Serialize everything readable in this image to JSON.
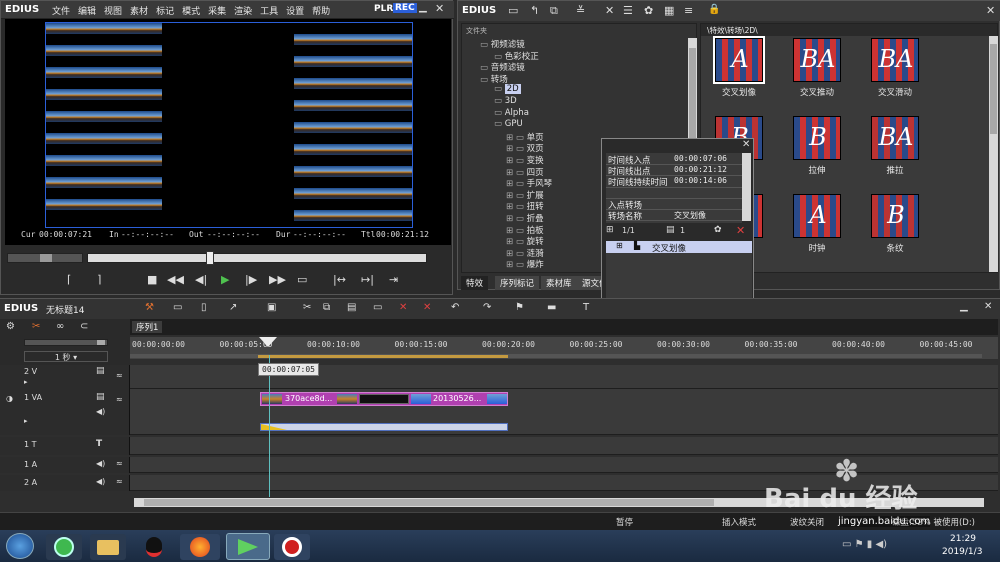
{
  "player": {
    "app_name": "EDIUS",
    "menu": [
      "文件",
      "编辑",
      "视图",
      "素材",
      "标记",
      "模式",
      "采集",
      "渲染",
      "工具",
      "设置",
      "帮助"
    ],
    "plr_label": "PLR",
    "rec_label": "REC",
    "timecodes": {
      "cur_label": "Cur",
      "cur_value": "00:00:07:21",
      "in_label": "In",
      "in_value": "--:--:--:--",
      "out_label": "Out",
      "out_value": "--:--:--:--",
      "dur_label": "Dur",
      "dur_value": "--:--:--:--",
      "ttl_label": "Ttl",
      "ttl_value": "00:00:21:12"
    }
  },
  "library": {
    "app_name": "EDIUS",
    "folder_header": "文件夹",
    "path": "\\特效\\转场\\2D\\",
    "tree": [
      {
        "label": "视频滤镜",
        "indent": 1
      },
      {
        "label": "色彩校正",
        "indent": 2
      },
      {
        "label": "音频滤镜",
        "indent": 1
      },
      {
        "label": "转场",
        "indent": 1
      },
      {
        "label": "2D",
        "indent": 2,
        "selected": true
      },
      {
        "label": "3D",
        "indent": 2
      },
      {
        "label": "Alpha",
        "indent": 2
      },
      {
        "label": "GPU",
        "indent": 2
      },
      {
        "label": "单页",
        "indent": 3
      },
      {
        "label": "双页",
        "indent": 3
      },
      {
        "label": "变换",
        "indent": 3
      },
      {
        "label": "四页",
        "indent": 3
      },
      {
        "label": "手风琴",
        "indent": 3
      },
      {
        "label": "扩展",
        "indent": 3
      },
      {
        "label": "扭转",
        "indent": 3
      },
      {
        "label": "折叠",
        "indent": 3
      },
      {
        "label": "拍板",
        "indent": 3
      },
      {
        "label": "旋转",
        "indent": 3
      },
      {
        "label": "涟漪",
        "indent": 3
      },
      {
        "label": "爆炸",
        "indent": 3
      }
    ],
    "thumbnails": [
      {
        "label": "交叉划像",
        "selected": true
      },
      {
        "label": "交叉推动"
      },
      {
        "label": "交叉滑动"
      },
      {
        "label": ""
      },
      {
        "label": "拉伸"
      },
      {
        "label": "推拉"
      },
      {
        "label": ""
      },
      {
        "label": "时钟"
      },
      {
        "label": "条纹"
      }
    ],
    "tabs": [
      "特效",
      "序列标记",
      "素材库",
      "源文件"
    ]
  },
  "info_panel": {
    "rows": [
      {
        "key": "时间线入点",
        "value": "00:00:07:06"
      },
      {
        "key": "时间线出点",
        "value": "00:00:21:12"
      },
      {
        "key": "时间线持续时间",
        "value": "00:00:14:06"
      },
      {
        "key": "",
        "value": ""
      },
      {
        "key": "入点转场",
        "value": ""
      },
      {
        "key": "转场名称",
        "value": "交叉划像"
      }
    ],
    "count_label": "1/1",
    "count2": "1",
    "list_item": "交叉划像",
    "tab_label": "信息"
  },
  "timeline": {
    "app_name": "EDIUS",
    "project": "无标题14",
    "sequence_tab": "序列1",
    "scale_label": "1 秒",
    "ruler_ticks": [
      "00:00:00:00",
      "00:00:05:00",
      "00:00:10:00",
      "00:00:15:00",
      "00:00:20:00",
      "00:00:25:00",
      "00:00:30:00",
      "00:00:35:00",
      "00:00:40:00",
      "00:00:45:00"
    ],
    "playhead_tooltip": "00:00:07:05",
    "tracks": [
      {
        "name": "2 V"
      },
      {
        "name": "1 VA"
      },
      {
        "name": "1 T"
      },
      {
        "name": "1 A"
      },
      {
        "name": "2 A"
      }
    ],
    "clip1": "370ace8d...",
    "clip2": "20130526..."
  },
  "statusbar": {
    "state": "暂停",
    "mode": "插入模式",
    "ripple": "波纹关闭",
    "disk": "磁盘:52% 被使用(D:)"
  },
  "taskbar": {
    "time": "21:29",
    "date": "2019/1/3"
  },
  "watermark": {
    "brand": "Bai du 经验",
    "url": "jingyan.baidu.com"
  },
  "colors": {
    "accent_blue": "#2b5fd9",
    "clip_magenta": "#b040b0",
    "selection": "#c8d0f0"
  }
}
